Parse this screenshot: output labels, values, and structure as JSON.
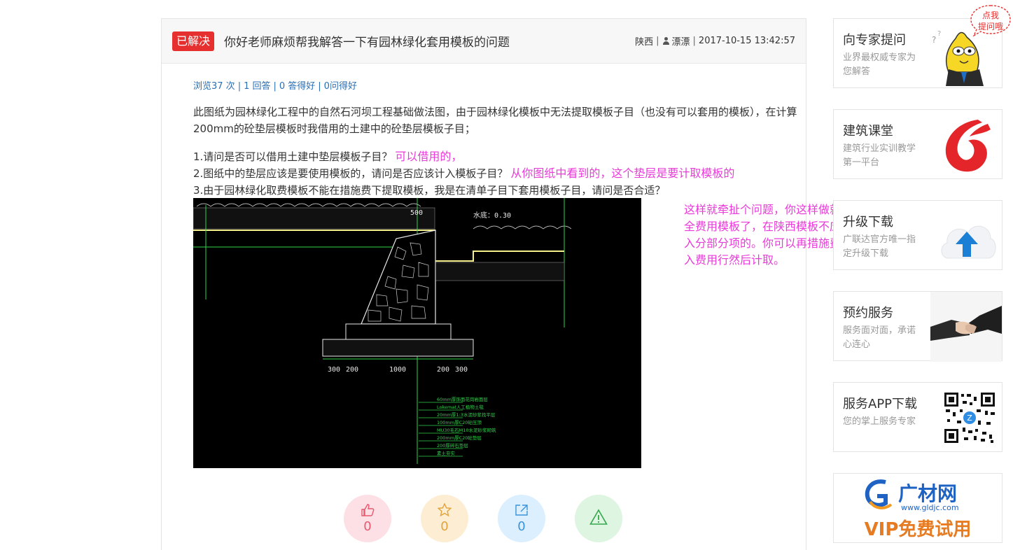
{
  "question": {
    "badge": "已解决",
    "title": "你好老师麻烦帮我解答一下有园林绿化套用模板的问题",
    "region": "陕西",
    "user": "漂漂",
    "datetime": "2017-10-15 13:42:57",
    "sep": "|"
  },
  "stats": {
    "views": "浏览37 次",
    "answers": "1 回答",
    "good_answers": "0 答得好",
    "got_good": "0问得好"
  },
  "description": "此图纸为园林绿化工程中的自然石河坝工程基础做法图，由于园林绿化模板中无法提取模板子目（也没有可以套用的模板），在计算200mm的砼垫层模板时我借用的土建中的砼垫层模板子目；",
  "sub_questions": [
    {
      "text": "1.请问是否可以借用土建中垫层模板子目？",
      "answer": "可以借用的，"
    },
    {
      "text": "2.图纸中的垫层应该是要使用模板的，请问是否应该计入模板子目？",
      "answer": "从你图纸中看到的，这个垫层是要计取模板的"
    },
    {
      "text": "3.由于园林绿化取费模板不能在措施费下提取模板，我是在清单子目下套用模板子目，请问是否合适？",
      "answer": ""
    }
  ],
  "note_answer": "这样就牵扯个问题，你这样做就成了全费用模板了，在陕西模板不应该计入分部分项的。你可以再措施费中插入费用行然后计取。",
  "drawing": {
    "dims": [
      "500",
      "300",
      "200",
      "1000",
      "200",
      "300"
    ],
    "water_level": "水底：0.30",
    "legend": [
      "60mm厚饰面花岗岩面层",
      "Lokemat人工植物土毯",
      "20mm厚1:3水泥砂浆找平层",
      "100mm厚C20砼压顶",
      "MU30毛石M10水泥砂浆砌筑",
      "200mm厚C20砼垫层",
      "200厚碎石垫层",
      "素土夯实"
    ],
    "colors": {
      "line": "#f5f08a",
      "green": "#2fd34a",
      "white": "#e8e8e8"
    }
  },
  "actions": [
    {
      "name": "like",
      "count": "0"
    },
    {
      "name": "favorite",
      "count": "0"
    },
    {
      "name": "share",
      "count": "0"
    },
    {
      "name": "report",
      "count": ""
    }
  ],
  "sidebar": {
    "bubble": [
      "点我",
      "提问哦"
    ],
    "items": [
      {
        "title": "向专家提问",
        "desc": "业界最权威专家为您解答"
      },
      {
        "title": "建筑课堂",
        "desc": "建筑行业实训教学第一平台"
      },
      {
        "title": "升级下载",
        "desc": "广联达官方唯一指定升级下载"
      },
      {
        "title": "预约服务",
        "desc": "服务面对面，承诺心连心"
      },
      {
        "title": "服务APP下载",
        "desc": "您的掌上服务专家"
      }
    ],
    "vip": {
      "brand": "广材网",
      "url": "www.gldjc.com",
      "slogan": "VIP免费试用"
    }
  },
  "colors": {
    "accent_red": "#e5302f",
    "link_blue": "#2a6fb4",
    "answer_pink": "#e83bd8"
  }
}
